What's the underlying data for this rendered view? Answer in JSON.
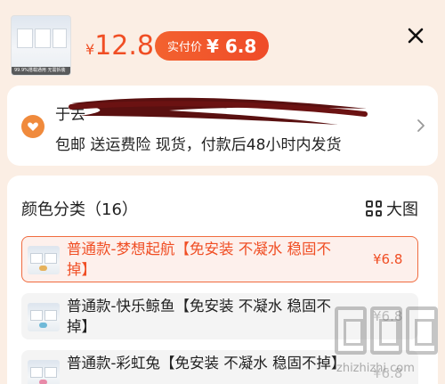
{
  "header": {
    "currency": "¥",
    "price": "12.8",
    "actual_price_label": "实付价",
    "actual_price_value": "¥ 6.8",
    "thumb_caption": "99.9%搭载通用  无需拆装"
  },
  "shipping": {
    "title": "于去",
    "detail": "包邮  送运费险  现货，付款后48小时内发货"
  },
  "options": {
    "header": "颜色分类（16）",
    "big_view_label": "大图",
    "variants": [
      {
        "name": "普通款-梦想起航【免安装 不凝水 稳固不掉】",
        "price": "¥6.8",
        "selected": true,
        "accent": "#e6b25c"
      },
      {
        "name": "普通款-快乐鲸鱼【免安装 不凝水 稳固不掉】",
        "price": "¥6.8",
        "selected": false,
        "accent": "#6fb9d8"
      },
      {
        "name": "普通款-彩虹兔【免安装 不凝水 稳固不掉】",
        "price": "¥6.8",
        "selected": false,
        "accent": "#e88aa8"
      }
    ]
  },
  "watermark": {
    "text": "zhizhizhi.com"
  },
  "colors": {
    "accent": "#f04e24",
    "background": "#fbeee4",
    "card": "#ffffff"
  }
}
